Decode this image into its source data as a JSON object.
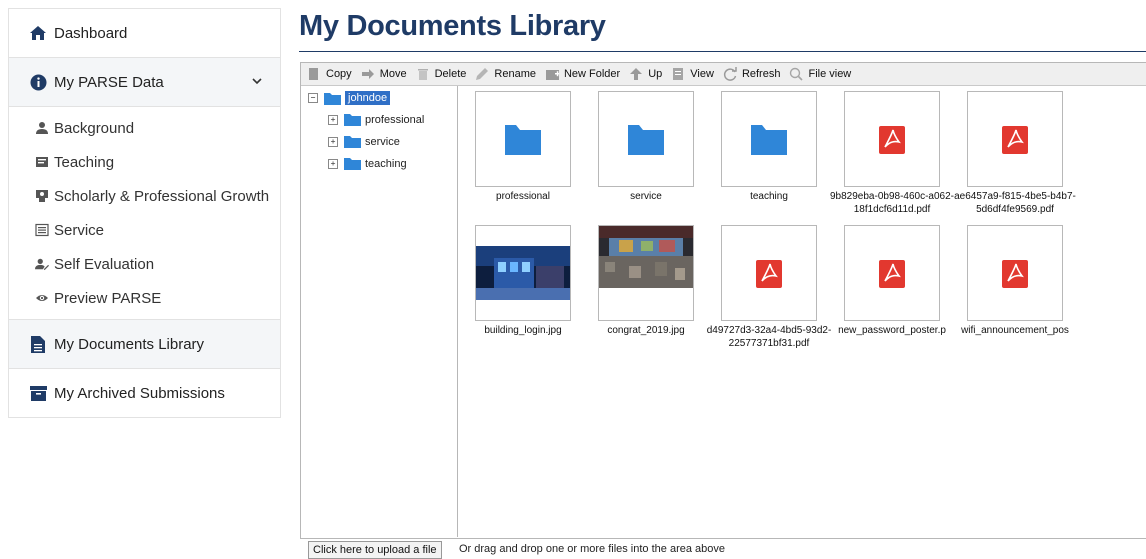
{
  "sidebar": {
    "dashboard": "Dashboard",
    "parse": "My PARSE Data",
    "sub": [
      "Background",
      "Teaching",
      "Scholarly & Professional Growth",
      "Service",
      "Self Evaluation",
      "Preview PARSE"
    ],
    "documents": "My Documents Library",
    "archived": "My Archived Submissions"
  },
  "main": {
    "title": "My Documents Library"
  },
  "toolbar": {
    "copy": "Copy",
    "move": "Move",
    "delete": "Delete",
    "rename": "Rename",
    "new_folder": "New Folder",
    "up": "Up",
    "view": "View",
    "refresh": "Refresh",
    "file_view": "File view"
  },
  "tree": {
    "root": "johndoe",
    "children": [
      "professional",
      "service",
      "teaching"
    ]
  },
  "files": [
    {
      "name": "professional",
      "kind": "folder"
    },
    {
      "name": "service",
      "kind": "folder"
    },
    {
      "name": "teaching",
      "kind": "folder"
    },
    {
      "name": "9b829eba-0b98-460c-a062-18f1dcf6d11d.pdf",
      "kind": "pdf"
    },
    {
      "name": "ae6457a9-f815-4be5-b4b7-5d6df4fe9569.pdf",
      "kind": "pdf"
    },
    {
      "name": "building_login.jpg",
      "kind": "image"
    },
    {
      "name": "congrat_2019.jpg",
      "kind": "image"
    },
    {
      "name": "d49727d3-32a4-4bd5-93d2-22577371bf31.pdf",
      "kind": "pdf"
    },
    {
      "name": "new_password_poster.p",
      "kind": "pdf"
    },
    {
      "name": "wifi_announcement_pos",
      "kind": "pdf"
    }
  ],
  "upload": {
    "button": "Click here to upload a file",
    "hint": "Or drag and drop one or more files into the area above"
  },
  "colors": {
    "title": "#1f3b66",
    "folder": "#2f86d8",
    "pdf": "#e2382f",
    "selection": "#2f6fc6"
  }
}
